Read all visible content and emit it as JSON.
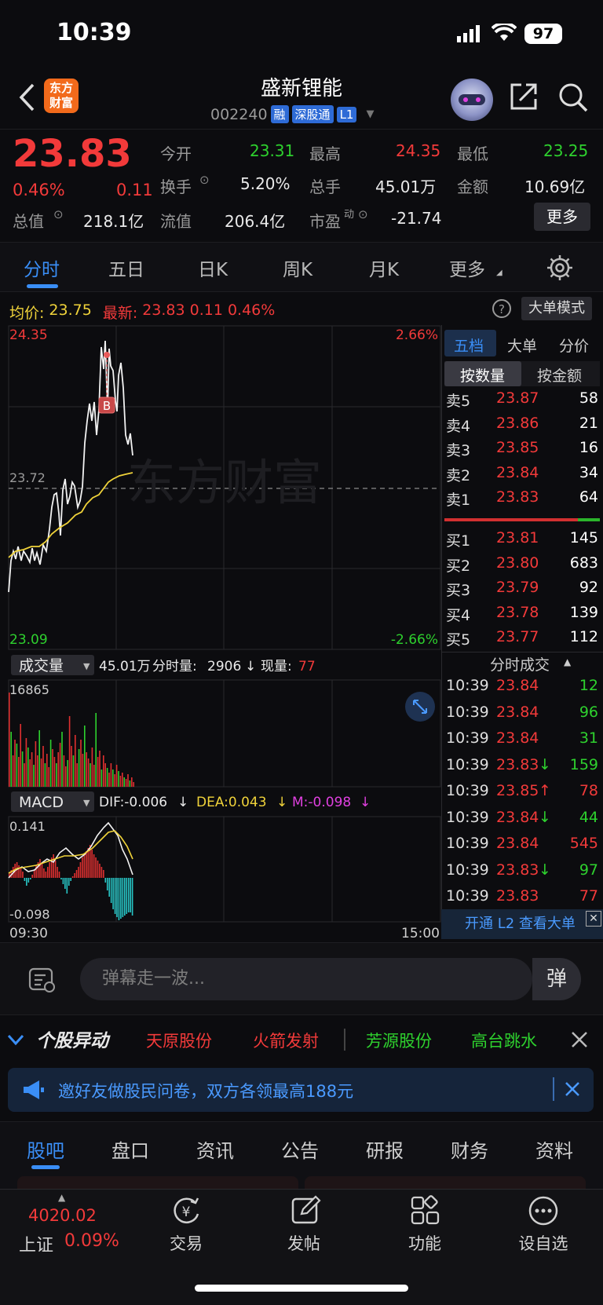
{
  "status": {
    "time": "10:39",
    "battery": "97"
  },
  "header": {
    "logo_line1": "东方",
    "logo_line2": "财富",
    "title": "盛新锂能",
    "code": "002240",
    "tags": [
      "融",
      "深股通",
      "L1"
    ]
  },
  "quote": {
    "price": "23.83",
    "change_pct": "0.46%",
    "change": "0.11",
    "fields": [
      {
        "label": "今开",
        "value": "23.31",
        "color": "green"
      },
      {
        "label": "最高",
        "value": "24.35",
        "color": "red"
      },
      {
        "label": "最低",
        "value": "23.25",
        "color": "green"
      },
      {
        "label": "换手",
        "value": "5.20%",
        "color": "white"
      },
      {
        "label": "总手",
        "value": "45.01万",
        "color": "white"
      },
      {
        "label": "金额",
        "value": "10.69亿",
        "color": "white"
      },
      {
        "label": "总值",
        "value": "218.1亿",
        "color": "white"
      },
      {
        "label": "流值",
        "value": "206.4亿",
        "color": "white"
      },
      {
        "label": "市盈",
        "value": "-21.74",
        "color": "white"
      }
    ],
    "pe_superscript": "动",
    "more_label": "更多"
  },
  "chart_tabs": [
    "分时",
    "五日",
    "日K",
    "周K",
    "月K",
    "更多"
  ],
  "info_line": {
    "avg_label": "均价:",
    "avg_value": "23.75",
    "latest_label": "最新:",
    "latest_value": "23.83",
    "latest_change": "0.11",
    "latest_pct": "0.46%",
    "big_mode": "大单模式"
  },
  "intraday": {
    "price_high": "24.35",
    "price_low": "23.09",
    "price_mid": "23.72",
    "pct_high": "2.66%",
    "pct_low": "-2.66%",
    "watermark": "东方财富",
    "marker": "B",
    "time_start": "09:30",
    "time_end": "15:00"
  },
  "volume": {
    "selector": "成交量",
    "total": "45.01万",
    "minute_label": "分时量:",
    "minute_value": "2906",
    "now_label": "现量:",
    "now_value": "77",
    "max": "16865"
  },
  "macd": {
    "selector": "MACD",
    "dif": "DIF:-0.006",
    "dea": "DEA:0.043",
    "m": "M:-0.098",
    "max": "0.141",
    "min": "-0.098"
  },
  "orderbook": {
    "tabs": [
      "五档",
      "大单",
      "分价"
    ],
    "modes": [
      "按数量",
      "按金额"
    ],
    "asks": [
      {
        "label": "卖5",
        "price": "23.87",
        "qty": "58"
      },
      {
        "label": "卖4",
        "price": "23.86",
        "qty": "21"
      },
      {
        "label": "卖3",
        "price": "23.85",
        "qty": "16"
      },
      {
        "label": "卖2",
        "price": "23.84",
        "qty": "34"
      },
      {
        "label": "卖1",
        "price": "23.83",
        "qty": "64"
      }
    ],
    "bids": [
      {
        "label": "买1",
        "price": "23.81",
        "qty": "145"
      },
      {
        "label": "买2",
        "price": "23.80",
        "qty": "683"
      },
      {
        "label": "买3",
        "price": "23.79",
        "qty": "92"
      },
      {
        "label": "买4",
        "price": "23.78",
        "qty": "139"
      },
      {
        "label": "买5",
        "price": "23.77",
        "qty": "112"
      }
    ],
    "trades_title": "分时成交",
    "trades": [
      {
        "time": "10:39",
        "price": "23.84",
        "arrow": "",
        "qty": "12",
        "qcolor": "green"
      },
      {
        "time": "10:39",
        "price": "23.84",
        "arrow": "",
        "qty": "96",
        "qcolor": "green"
      },
      {
        "time": "10:39",
        "price": "23.84",
        "arrow": "",
        "qty": "31",
        "qcolor": "green"
      },
      {
        "time": "10:39",
        "price": "23.83",
        "arrow": "↓",
        "qty": "159",
        "qcolor": "green"
      },
      {
        "time": "10:39",
        "price": "23.85",
        "arrow": "↑",
        "qty": "78",
        "qcolor": "red"
      },
      {
        "time": "10:39",
        "price": "23.84",
        "arrow": "↓",
        "qty": "44",
        "qcolor": "green"
      },
      {
        "time": "10:39",
        "price": "23.84",
        "arrow": "",
        "qty": "545",
        "qcolor": "red"
      },
      {
        "time": "10:39",
        "price": "23.83",
        "arrow": "↓",
        "qty": "97",
        "qcolor": "green"
      },
      {
        "time": "10:39",
        "price": "23.83",
        "arrow": "",
        "qty": "77",
        "qcolor": "red"
      }
    ],
    "l2_banner": "开通 L2 查看大单"
  },
  "danmaku": {
    "placeholder": "弹幕走一波...",
    "button": "弹"
  },
  "movement": {
    "title": "个股异动",
    "items": [
      {
        "label": "天原股份",
        "color": "red"
      },
      {
        "label": "火箭发射",
        "color": "red"
      },
      {
        "label": "芳源股份",
        "color": "green"
      },
      {
        "label": "高台跳水",
        "color": "green"
      }
    ]
  },
  "promo": {
    "text": "邀好友做股民问卷，双方各领最高188元"
  },
  "sub_tabs": [
    "股吧",
    "盘口",
    "资讯",
    "公告",
    "研报",
    "财务",
    "资料"
  ],
  "tab_bar": {
    "index_value": "4020.02",
    "index_name": "上证",
    "index_pct": "0.09%",
    "items": [
      "交易",
      "发帖",
      "功能",
      "设自选"
    ]
  },
  "colors": {
    "up": "#f23a3a",
    "down": "#2ed12e",
    "accent": "#3a8ef6",
    "avg_line": "#f0d33a",
    "macd_neg": "#27c6c6"
  }
}
